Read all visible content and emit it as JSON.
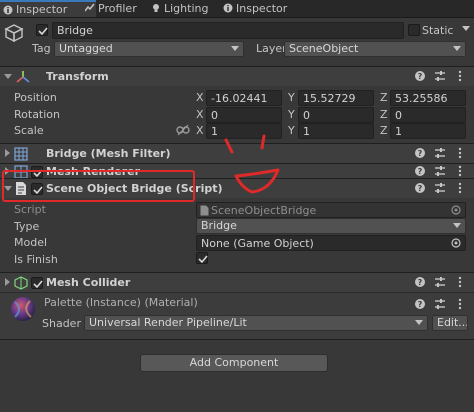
{
  "tabs": [
    {
      "label": "Inspector",
      "icon": "info-icon",
      "active": true
    },
    {
      "label": "Profiler",
      "icon": "profiler-icon",
      "active": false
    },
    {
      "label": "Lighting",
      "icon": "lighting-icon",
      "active": false
    },
    {
      "label": "Inspector",
      "icon": "info-icon",
      "active": false
    }
  ],
  "object": {
    "name": "Bridge",
    "static_label": "Static",
    "tag_label": "Tag",
    "tag_value": "Untagged",
    "layer_label": "Layer",
    "layer_value": "SceneObject"
  },
  "transform": {
    "title": "Transform",
    "rows": [
      {
        "label": "Position",
        "x": "-16.02441",
        "y": "15.52729",
        "z": "53.25586"
      },
      {
        "label": "Rotation",
        "x": "0",
        "y": "0",
        "z": "0"
      },
      {
        "label": "Scale",
        "x": "1",
        "y": "1",
        "z": "1"
      }
    ],
    "axis": [
      "X",
      "Y",
      "Z"
    ]
  },
  "mesh_filter": {
    "title": "Bridge (Mesh Filter)"
  },
  "mesh_renderer": {
    "title": "Mesh Renderer"
  },
  "script_component": {
    "title": "Scene Object Bridge (Script)",
    "script_label": "Script",
    "script_value": "SceneObjectBridge",
    "type_label": "Type",
    "type_value": "Bridge",
    "model_label": "Model",
    "model_value": "None (Game Object)",
    "finish_label": "Is Finish"
  },
  "mesh_collider": {
    "title": "Mesh Collider"
  },
  "material": {
    "name": "Palette (Instance) (Material)",
    "shader_label": "Shader",
    "shader_value": "Universal Render Pipeline/Lit",
    "edit_label": "Edit..."
  },
  "add_component_label": "Add Component",
  "colors": {
    "highlight": "#e02a2a",
    "accent": "#3a79bb"
  }
}
